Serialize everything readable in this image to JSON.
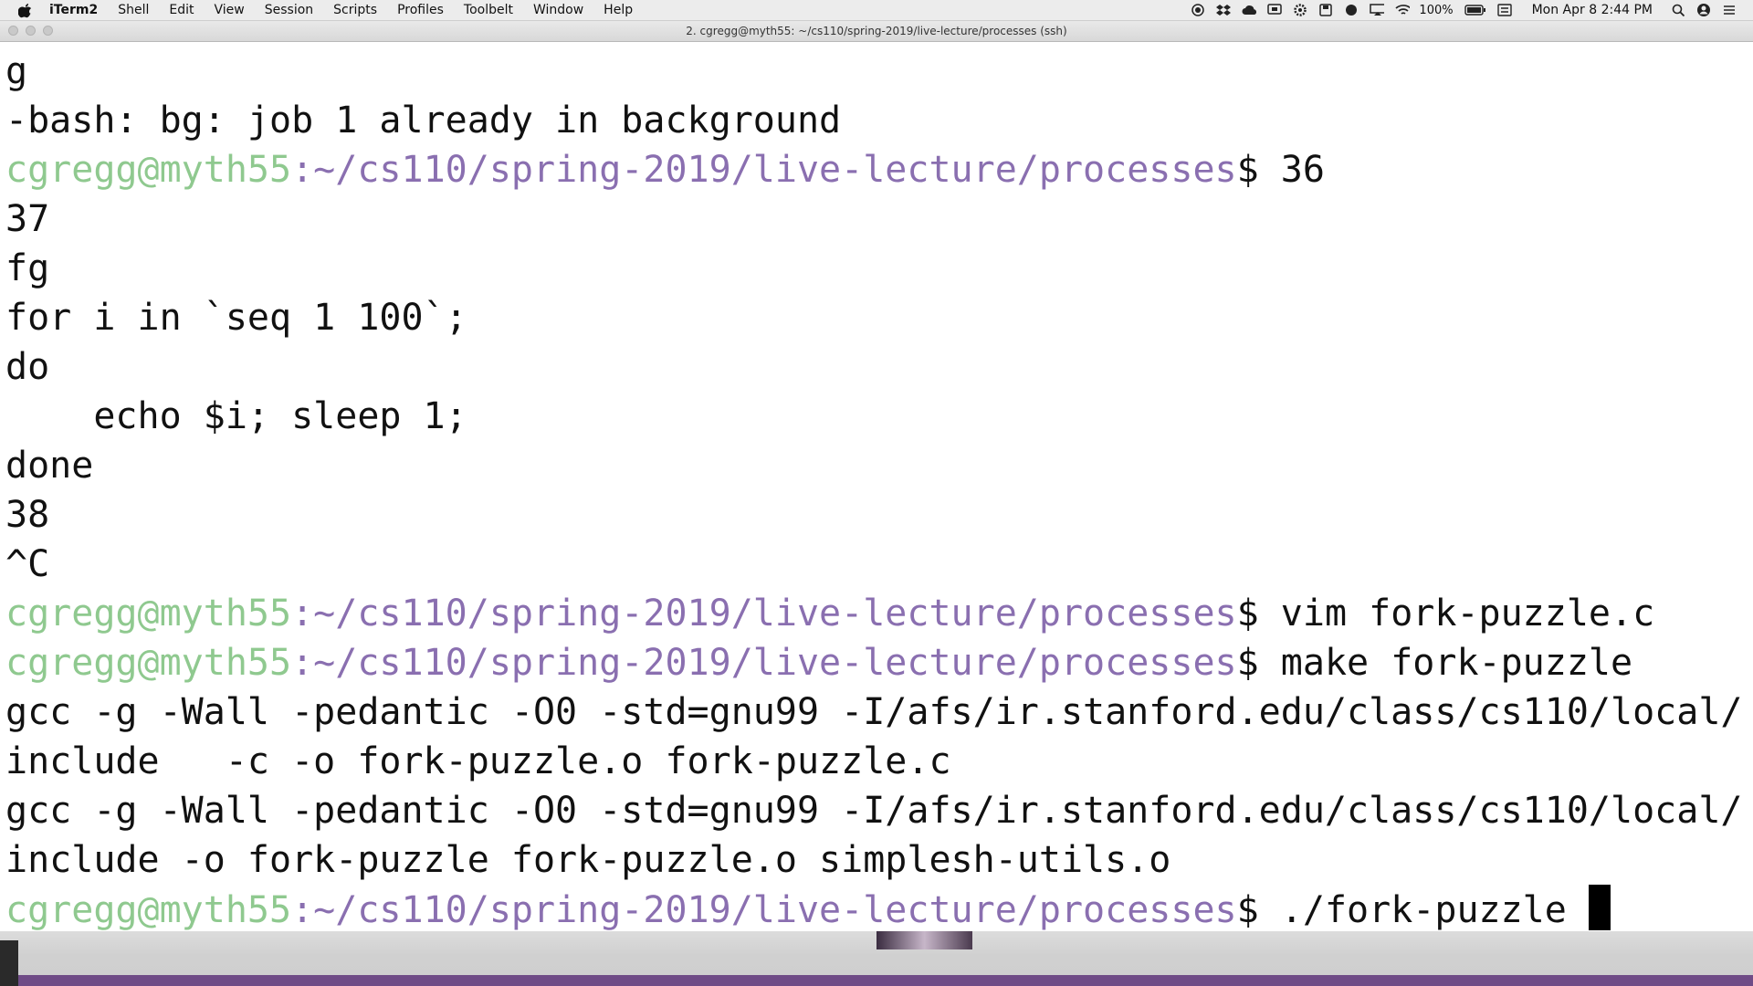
{
  "menubar": {
    "app_name": "iTerm2",
    "menus": [
      "Shell",
      "Edit",
      "View",
      "Session",
      "Scripts",
      "Profiles",
      "Toolbelt",
      "Window",
      "Help"
    ],
    "battery": "100%",
    "clock": "Mon Apr 8  2:44 PM",
    "status_icons": [
      "record-icon",
      "dropbox-icon",
      "cloud-icon",
      "screen-share-icon",
      "gear-icon",
      "save-icon",
      "circle-icon",
      "airplay-icon",
      "wifi-icon",
      "battery-icon",
      "keyboard-icon",
      "search-icon",
      "user-icon",
      "list-icon"
    ]
  },
  "window": {
    "title": "2. cgregg@myth55: ~/cs110/spring-2019/live-lecture/processes (ssh)"
  },
  "terminal": {
    "lines": [
      {
        "kind": "output",
        "text": "g"
      },
      {
        "kind": "output",
        "text": "-bash: bg: job 1 already in background"
      },
      {
        "kind": "prompt",
        "user": "cgregg@myth55",
        "path": ":~/cs110/spring-2019/live-lecture/processes",
        "symbol": "$ ",
        "cmd": "36"
      },
      {
        "kind": "output",
        "text": "37"
      },
      {
        "kind": "output",
        "text": "fg"
      },
      {
        "kind": "output",
        "text": "for i in `seq 1 100`;"
      },
      {
        "kind": "output",
        "text": "do"
      },
      {
        "kind": "output",
        "text": "    echo $i; sleep 1;"
      },
      {
        "kind": "output",
        "text": "done"
      },
      {
        "kind": "output",
        "text": "38"
      },
      {
        "kind": "output",
        "text": "^C"
      },
      {
        "kind": "prompt",
        "user": "cgregg@myth55",
        "path": ":~/cs110/spring-2019/live-lecture/processes",
        "symbol": "$ ",
        "cmd": "vim fork-puzzle.c"
      },
      {
        "kind": "prompt",
        "user": "cgregg@myth55",
        "path": ":~/cs110/spring-2019/live-lecture/processes",
        "symbol": "$ ",
        "cmd": "make fork-puzzle"
      },
      {
        "kind": "output",
        "text": "gcc -g -Wall -pedantic -O0 -std=gnu99 -I/afs/ir.stanford.edu/class/cs110/local/"
      },
      {
        "kind": "output",
        "text": "include   -c -o fork-puzzle.o fork-puzzle.c"
      },
      {
        "kind": "output",
        "text": "gcc -g -Wall -pedantic -O0 -std=gnu99 -I/afs/ir.stanford.edu/class/cs110/local/"
      },
      {
        "kind": "output",
        "text": "include -o fork-puzzle fork-puzzle.o simplesh-utils.o"
      },
      {
        "kind": "prompt",
        "user": "cgregg@myth55",
        "path": ":~/cs110/spring-2019/live-lecture/processes",
        "symbol": "$ ",
        "cmd": "./fork-puzzle ",
        "cursor": true
      }
    ]
  },
  "colors": {
    "prompt_user": "#8fc98f",
    "prompt_path": "#8a6fb0",
    "text": "#111111",
    "background": "#ffffff"
  }
}
